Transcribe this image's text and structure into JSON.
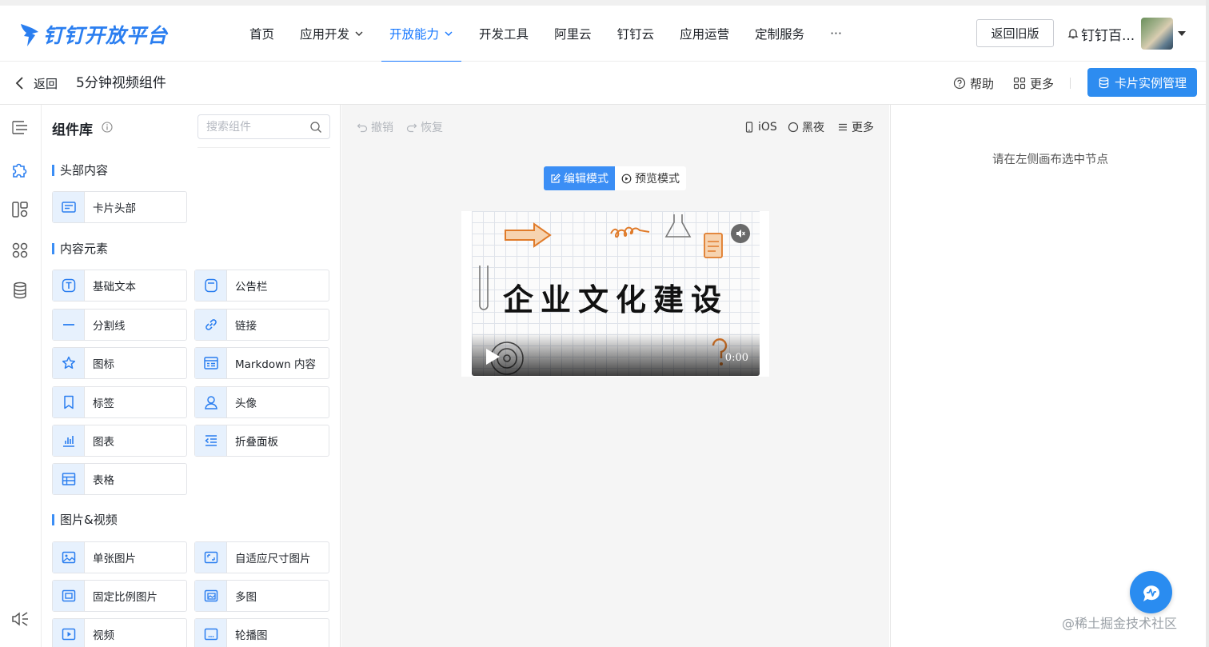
{
  "brand": {
    "name": "钉钉开放平台",
    "color": "#2a7ef0"
  },
  "nav": {
    "items": [
      {
        "label": "首页"
      },
      {
        "label": "应用开发",
        "dropdown": true
      },
      {
        "label": "开放能力",
        "dropdown": true,
        "active": true
      },
      {
        "label": "开发工具"
      },
      {
        "label": "阿里云"
      },
      {
        "label": "钉钉云"
      },
      {
        "label": "应用运营"
      },
      {
        "label": "定制服务"
      },
      {
        "label": "···"
      }
    ],
    "back_to_old": "返回旧版",
    "user_name": "钉钉百...",
    "accent": "#1677ff"
  },
  "subheader": {
    "back_label": "返回",
    "page_title": "5分钟视频组件",
    "help_label": "帮助",
    "more_label": "更多",
    "primary_button": "卡片实例管理",
    "primary_color": "#2d8cf0"
  },
  "rail": {
    "icons": [
      "outline-icon",
      "puzzle-icon",
      "layout-icon",
      "apps-icon",
      "database-icon",
      "sound-settings-icon"
    ]
  },
  "library": {
    "title": "组件库",
    "search_placeholder": "搜索组件",
    "sections": [
      {
        "title": "头部内容",
        "items": [
          {
            "label": "卡片头部",
            "icon": "card-header-icon"
          }
        ]
      },
      {
        "title": "内容元素",
        "items": [
          {
            "label": "基础文本",
            "icon": "text-icon"
          },
          {
            "label": "公告栏",
            "icon": "notice-icon"
          },
          {
            "label": "分割线",
            "icon": "divider-icon"
          },
          {
            "label": "链接",
            "icon": "link-icon"
          },
          {
            "label": "图标",
            "icon": "star-icon"
          },
          {
            "label": "Markdown 内容",
            "icon": "markdown-icon"
          },
          {
            "label": "标签",
            "icon": "bookmark-icon"
          },
          {
            "label": "头像",
            "icon": "user-icon"
          },
          {
            "label": "图表",
            "icon": "chart-icon"
          },
          {
            "label": "折叠面板",
            "icon": "collapse-icon"
          },
          {
            "label": "表格",
            "icon": "table-icon"
          }
        ]
      },
      {
        "title": "图片&视频",
        "items": [
          {
            "label": "单张图片",
            "icon": "image-icon"
          },
          {
            "label": "自适应尺寸图片",
            "icon": "adaptive-image-icon"
          },
          {
            "label": "固定比例图片",
            "icon": "fixed-ratio-image-icon"
          },
          {
            "label": "多图",
            "icon": "multi-image-icon"
          },
          {
            "label": "视频",
            "icon": "video-icon"
          },
          {
            "label": "轮播图",
            "icon": "carousel-icon"
          }
        ]
      }
    ]
  },
  "canvas": {
    "undo_label": "撤销",
    "redo_label": "恢复",
    "ios_label": "iOS",
    "dark_label": "黑夜",
    "more_label": "更多",
    "edit_mode_label": "编辑模式",
    "preview_mode_label": "预览模式",
    "video": {
      "title_text": "企业文化建设",
      "time": "0:00",
      "muted": true
    }
  },
  "props": {
    "hint": "请在左侧画布选中节点"
  },
  "watermark": "@稀土掘金技术社区"
}
